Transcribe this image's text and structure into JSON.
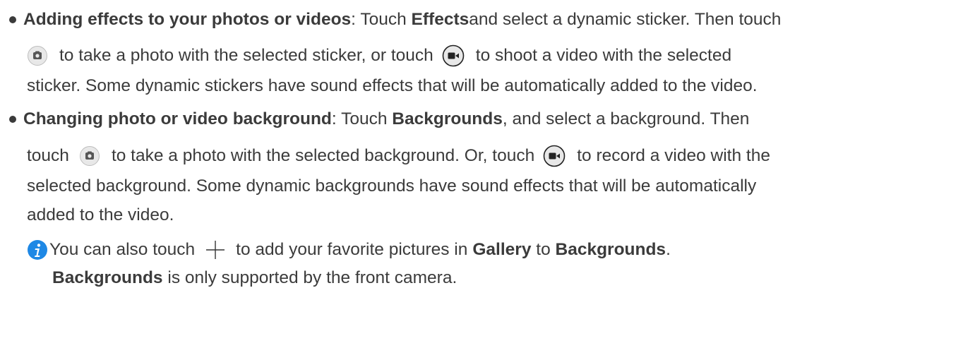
{
  "item1": {
    "title": "Adding effects to your photos or videos",
    "colon": ":",
    "t1": " Touch ",
    "b1": "Effects",
    "t2": " and select a dynamic sticker. Then touch",
    "l2a": "to take a photo with the selected sticker, or touch",
    "l2b": "to shoot a video with the selected",
    "l3": "sticker. Some dynamic stickers have sound effects that will be automatically added to the video."
  },
  "item2": {
    "title": "Changing photo or video background",
    "colon": ":",
    "t1": " Touch ",
    "b1": "Backgrounds",
    "t2": ", and select a background. Then",
    "l2a": "touch",
    "l2b": "to take a photo with the selected background. Or, touch",
    "l2c": "to record a video with the",
    "l3": "selected background. Some dynamic backgrounds have sound effects that will be automatically",
    "l4": "added to the video."
  },
  "note": {
    "n1a": "You can also touch",
    "n1b": "to add your favorite pictures in",
    "b_gallery": "Gallery",
    "to": " to ",
    "b_bg": "Backgrounds",
    "period": ".",
    "b_bg2": "Backgrounds",
    "n2": " is only supported by the front camera."
  },
  "icons": {
    "photo": "camera-shutter-icon",
    "video": "video-record-icon",
    "add": "plus-icon",
    "info": "info-icon"
  },
  "colors": {
    "text": "#3b3b3b",
    "icon_bg": "#e6e6e6",
    "info_blue": "#1e88e5"
  }
}
